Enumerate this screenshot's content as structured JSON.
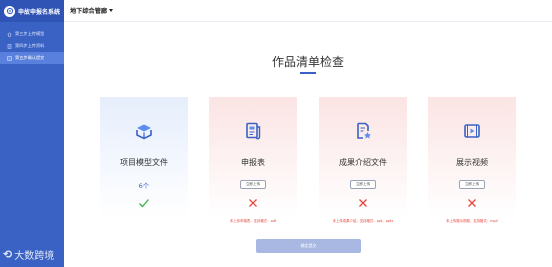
{
  "app": {
    "title": "申故申报名系统"
  },
  "sidebar": {
    "items": [
      {
        "label": "第三步上传模型",
        "icon": "home-icon",
        "active": false
      },
      {
        "label": "第四步上传资料",
        "icon": "document-icon",
        "active": false
      },
      {
        "label": "第五步确认提交",
        "icon": "checklist-icon",
        "active": true
      }
    ]
  },
  "header": {
    "project_name": "地下综合管廊"
  },
  "main": {
    "title": "作品清单检查",
    "cards": [
      {
        "name": "项目模型文件",
        "count": "6个",
        "status": "ok",
        "icon": "cube-box-icon",
        "upload_label": "",
        "hint": ""
      },
      {
        "name": "申报表",
        "count": "",
        "status": "missing",
        "icon": "report-icon",
        "upload_label": "立即上传",
        "hint": "未上传申报表，支持格式：pdf"
      },
      {
        "name": "成果介绍文件",
        "count": "",
        "status": "missing",
        "icon": "document-star-icon",
        "upload_label": "立即上传",
        "hint": "未上传成果介绍，支持格式：ppt、pptx"
      },
      {
        "name": "展示视频",
        "count": "",
        "status": "missing",
        "icon": "video-icon",
        "upload_label": "立即上传",
        "hint": "未上传展示视频，支持格式：mp4"
      }
    ],
    "submit_label": "确定提交"
  },
  "watermark": {
    "text": "大数跨境"
  },
  "colors": {
    "primary": "#3a62c4",
    "success": "#3cb043",
    "error": "#e8453c"
  }
}
